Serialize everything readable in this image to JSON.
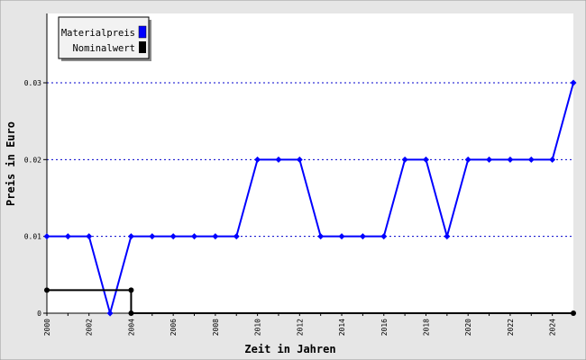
{
  "colors": {
    "background": "#e6e6e6",
    "plot_background": "#ffffff",
    "material": "#0000ff",
    "nominal": "#000000",
    "grid": "#0000cc"
  },
  "chart_data": {
    "type": "line",
    "title": "",
    "xlabel": "Zeit in Jahren",
    "ylabel": "Preis in Euro",
    "xlim": [
      2000,
      2025
    ],
    "ylim": [
      0,
      0.03
    ],
    "x_ticks": [
      2000,
      2002,
      2004,
      2006,
      2008,
      2010,
      2012,
      2014,
      2016,
      2018,
      2020,
      2022,
      2024
    ],
    "y_ticks": [
      "0",
      "0.01",
      "0.02",
      "0.03"
    ],
    "grid": "horizontal dotted",
    "legend_position": "top-left",
    "series": [
      {
        "name": "Materialpreis",
        "color": "#0000ff",
        "style": "line-with-markers",
        "points": [
          [
            2000,
            0.01
          ],
          [
            2001,
            0.01
          ],
          [
            2002,
            0.01
          ],
          [
            2003,
            0.0
          ],
          [
            2004,
            0.01
          ],
          [
            2005,
            0.01
          ],
          [
            2006,
            0.01
          ],
          [
            2007,
            0.01
          ],
          [
            2008,
            0.01
          ],
          [
            2009,
            0.01
          ],
          [
            2010,
            0.02
          ],
          [
            2011,
            0.02
          ],
          [
            2012,
            0.02
          ],
          [
            2013,
            0.01
          ],
          [
            2014,
            0.01
          ],
          [
            2015,
            0.01
          ],
          [
            2016,
            0.01
          ],
          [
            2017,
            0.02
          ],
          [
            2018,
            0.02
          ],
          [
            2019,
            0.01
          ],
          [
            2020,
            0.02
          ],
          [
            2021,
            0.02
          ],
          [
            2022,
            0.02
          ],
          [
            2023,
            0.02
          ],
          [
            2024,
            0.02
          ],
          [
            2025,
            0.03
          ]
        ]
      },
      {
        "name": "Nominalwert",
        "color": "#000000",
        "style": "step",
        "points": [
          [
            2000,
            0.003
          ],
          [
            2004,
            0.003
          ],
          [
            2004,
            0.0
          ],
          [
            2025,
            0.0
          ]
        ]
      }
    ]
  }
}
